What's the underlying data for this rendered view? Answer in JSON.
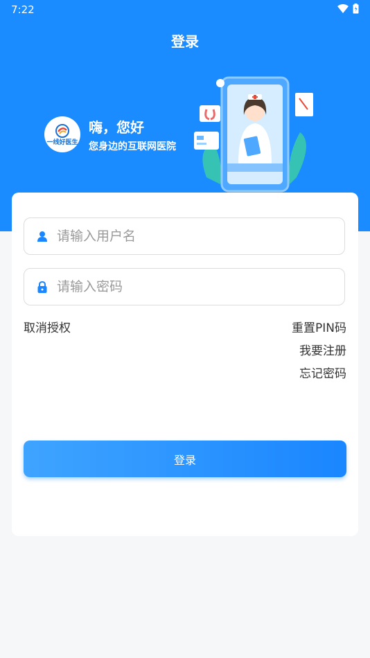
{
  "status_bar": {
    "time": "7:22"
  },
  "header": {
    "title": "登录",
    "greeting": "嗨，您好",
    "tagline": "您身边的互联网医院",
    "logo_text": "一线好医生"
  },
  "form": {
    "username_placeholder": "请输入用户名",
    "password_placeholder": "请输入密码"
  },
  "links": {
    "cancel_auth": "取消授权",
    "reset_pin": "重置PIN码",
    "register": "我要注册",
    "forgot_password": "忘记密码"
  },
  "login_button": "登录",
  "colors": {
    "primary": "#1a8cff",
    "background": "#f6f7f9"
  }
}
